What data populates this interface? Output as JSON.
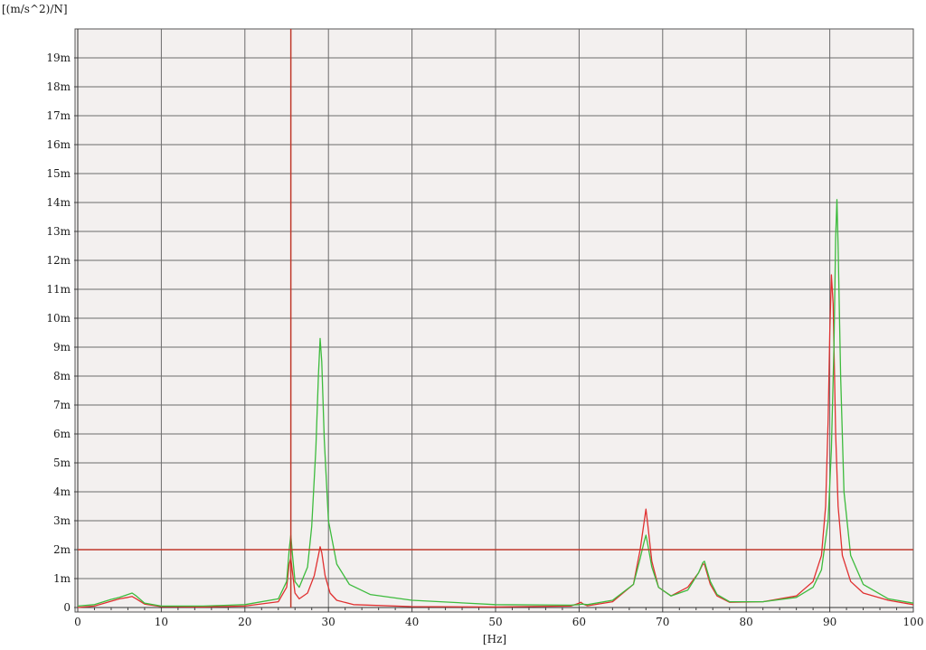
{
  "chart_data": {
    "type": "line",
    "title": "",
    "ylabel": "[(m/s^2)/N]",
    "xlabel": "[Hz]",
    "xlim": [
      0,
      100
    ],
    "ylim": [
      0,
      20
    ],
    "grid": true,
    "x_ticks": [
      {
        "value": 0,
        "label": "0"
      },
      {
        "value": 10,
        "label": "10"
      },
      {
        "value": 20,
        "label": "20"
      },
      {
        "value": 30,
        "label": "30"
      },
      {
        "value": 40,
        "label": "40"
      },
      {
        "value": 50,
        "label": "50"
      },
      {
        "value": 60,
        "label": "60"
      },
      {
        "value": 70,
        "label": "70"
      },
      {
        "value": 80,
        "label": "80"
      },
      {
        "value": 90,
        "label": "90"
      },
      {
        "value": 100,
        "label": "100"
      }
    ],
    "y_ticks": [
      {
        "value": 0,
        "label": "0"
      },
      {
        "value": 1,
        "label": "1m"
      },
      {
        "value": 2,
        "label": "2m"
      },
      {
        "value": 3,
        "label": "3m"
      },
      {
        "value": 4,
        "label": "4m"
      },
      {
        "value": 5,
        "label": "5m"
      },
      {
        "value": 6,
        "label": "6m"
      },
      {
        "value": 7,
        "label": "7m"
      },
      {
        "value": 8,
        "label": "8m"
      },
      {
        "value": 9,
        "label": "9m"
      },
      {
        "value": 10,
        "label": "10m"
      },
      {
        "value": 11,
        "label": "11m"
      },
      {
        "value": 12,
        "label": "12m"
      },
      {
        "value": 13,
        "label": "13m"
      },
      {
        "value": 14,
        "label": "14m"
      },
      {
        "value": 15,
        "label": "15m"
      },
      {
        "value": 16,
        "label": "16m"
      },
      {
        "value": 17,
        "label": "17m"
      },
      {
        "value": 18,
        "label": "18m"
      },
      {
        "value": 19,
        "label": "19m"
      }
    ],
    "cursor": {
      "x": 25.5,
      "y": 2.0,
      "color": "#c0392b"
    },
    "series": [
      {
        "color": "#e03030",
        "x": [
          0,
          2,
          4,
          5,
          6,
          6.5,
          7,
          8,
          10,
          15,
          20,
          24,
          25,
          25.3,
          25.5,
          25.7,
          26,
          26.5,
          27.5,
          28.3,
          28.8,
          29,
          29.2,
          29.6,
          30.2,
          31,
          33,
          40,
          50,
          59,
          60,
          60.2,
          60.5,
          61,
          64,
          66.5,
          67.3,
          67.8,
          68,
          68.2,
          68.7,
          69.5,
          71,
          73,
          74.3,
          74.8,
          75,
          75.2,
          75.7,
          76.5,
          78,
          82,
          86,
          88,
          89,
          89.5,
          89.8,
          90,
          90.2,
          90.4,
          90.7,
          91,
          91.5,
          92.5,
          94,
          97,
          100
        ],
        "y": [
          0,
          0.05,
          0.22,
          0.3,
          0.35,
          0.38,
          0.3,
          0.12,
          0.03,
          0.02,
          0.05,
          0.2,
          0.7,
          1.5,
          1.7,
          1.2,
          0.5,
          0.3,
          0.5,
          1.1,
          1.8,
          2.1,
          1.9,
          1.1,
          0.5,
          0.25,
          0.1,
          0.03,
          0.02,
          0.05,
          0.15,
          0.18,
          0.12,
          0.06,
          0.2,
          0.8,
          2.0,
          3.0,
          3.4,
          2.9,
          1.6,
          0.7,
          0.4,
          0.7,
          1.2,
          1.5,
          1.5,
          1.3,
          0.8,
          0.4,
          0.18,
          0.2,
          0.4,
          0.9,
          1.8,
          3.5,
          6.5,
          9.5,
          11.5,
          10.5,
          6.0,
          3.5,
          1.8,
          0.9,
          0.5,
          0.25,
          0.1
        ]
      },
      {
        "color": "#3dbb3d",
        "x": [
          0,
          2,
          4,
          5,
          6,
          6.5,
          7,
          8,
          10,
          15,
          20,
          24,
          25,
          25.3,
          25.5,
          25.7,
          26,
          26.5,
          27.5,
          28,
          28.5,
          28.8,
          29,
          29.2,
          29.5,
          30,
          31,
          32.5,
          35,
          40,
          50,
          59,
          60,
          60.3,
          61,
          64,
          66.5,
          67.3,
          67.8,
          68,
          68.2,
          68.7,
          69.5,
          71,
          73,
          74.3,
          74.8,
          75,
          75.2,
          75.7,
          76.5,
          78,
          82,
          86,
          88,
          89,
          89.8,
          90.2,
          90.5,
          90.7,
          90.85,
          91,
          91.3,
          91.7,
          92.5,
          94,
          97,
          100
        ],
        "y": [
          0.05,
          0.1,
          0.28,
          0.35,
          0.45,
          0.5,
          0.4,
          0.15,
          0.05,
          0.05,
          0.1,
          0.3,
          0.9,
          2.0,
          2.5,
          1.8,
          0.9,
          0.7,
          1.4,
          2.8,
          5.5,
          8.0,
          9.3,
          8.5,
          5.8,
          3.0,
          1.5,
          0.8,
          0.45,
          0.25,
          0.1,
          0.08,
          0.1,
          0.12,
          0.1,
          0.25,
          0.8,
          1.7,
          2.3,
          2.5,
          2.2,
          1.4,
          0.7,
          0.4,
          0.6,
          1.2,
          1.55,
          1.6,
          1.4,
          0.9,
          0.45,
          0.2,
          0.2,
          0.35,
          0.7,
          1.3,
          3.0,
          5.5,
          9.0,
          12.8,
          14.1,
          12.5,
          8.0,
          4.0,
          1.8,
          0.8,
          0.3,
          0.15
        ]
      }
    ]
  }
}
